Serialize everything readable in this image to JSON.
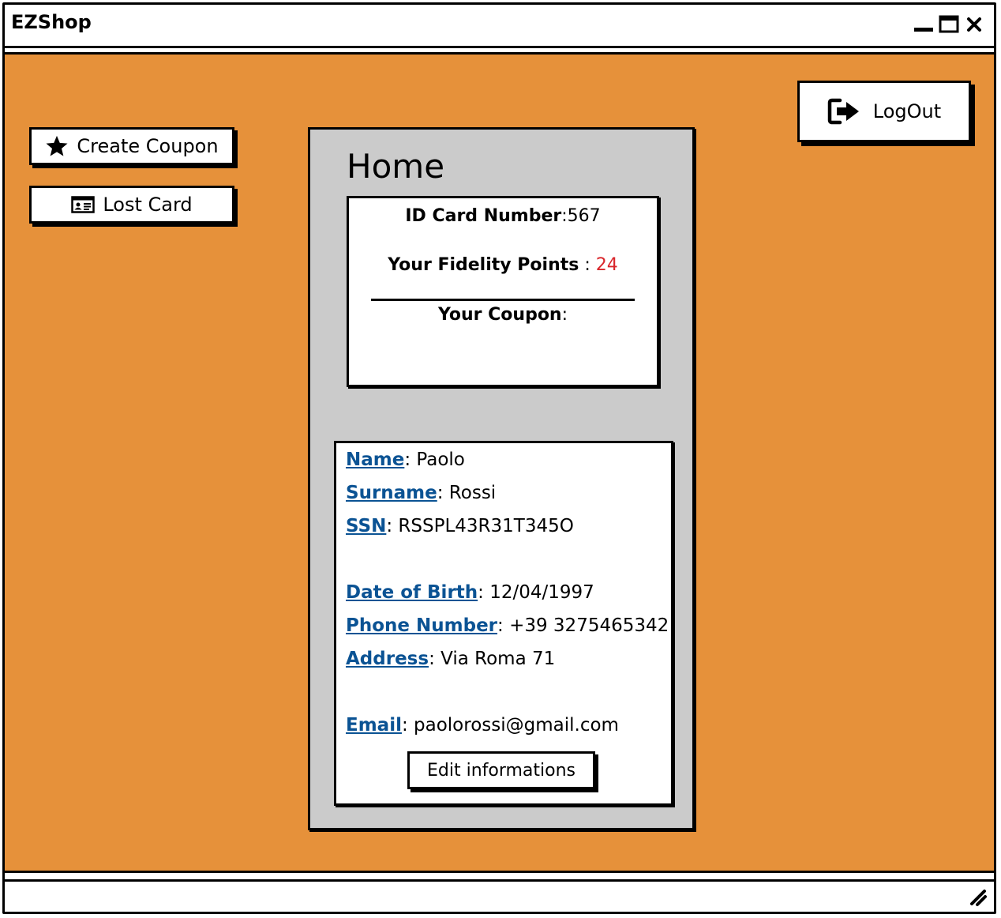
{
  "window": {
    "title": "EZShop"
  },
  "actions": {
    "create_coupon": "Create Coupon",
    "lost_card": "Lost Card",
    "logout": "LogOut"
  },
  "home": {
    "title": "Home",
    "card": {
      "id_label": "ID Card Number",
      "id_value": ":567",
      "points_label": "Your Fidelity Points",
      "points_sep": " : ",
      "points_value": "24",
      "coupon_label": "Your Coupon",
      "coupon_sep": ":"
    },
    "info": [
      {
        "label": "Name",
        "value": ": Paolo"
      },
      {
        "label": "Surname",
        "value": ": Rossi"
      },
      {
        "label": "SSN",
        "value": ": RSSPL43R31T345O"
      },
      {
        "label": "Date of Birth",
        "value": ": 12/04/1997"
      },
      {
        "label": "Phone Number",
        "value": ": +39 3275465342"
      },
      {
        "label": "Address",
        "value": ": Via Roma 71"
      },
      {
        "label": "Email",
        "value": ": paolorossi@gmail.com"
      }
    ],
    "edit_label": "Edit informations"
  },
  "colors": {
    "background": "#e6913a",
    "panel": "#cbcbcb",
    "link": "#0b5394",
    "points": "#d9262b"
  }
}
